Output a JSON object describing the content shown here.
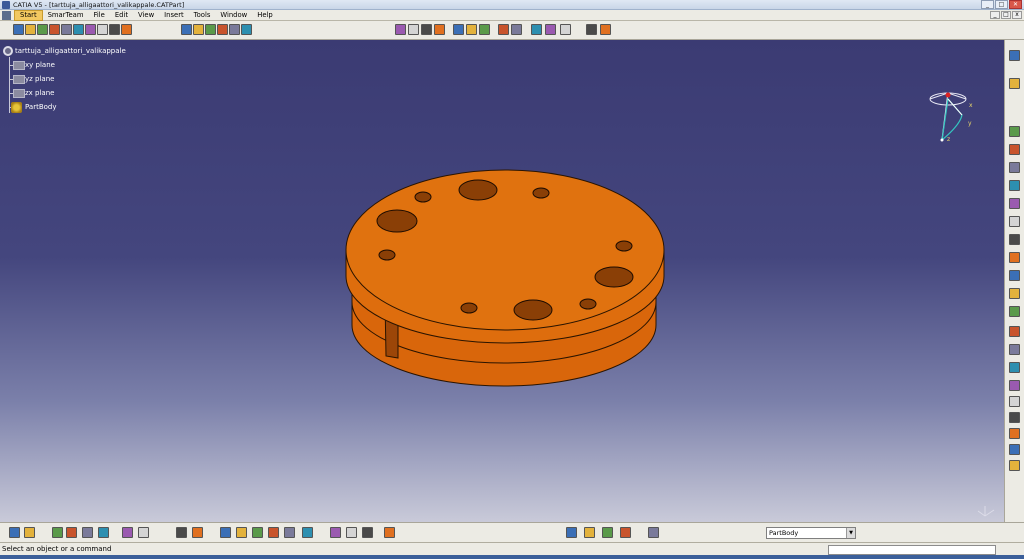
{
  "window": {
    "title": "CATIA V5 - [tarttuja_alligaattori_valikappale.CATPart]",
    "min_label": "_",
    "max_label": "□",
    "close_label": "✕"
  },
  "menu": {
    "items": [
      {
        "label": "Start"
      },
      {
        "label": "SmarTeam"
      },
      {
        "label": "File"
      },
      {
        "label": "Edit"
      },
      {
        "label": "View"
      },
      {
        "label": "Insert"
      },
      {
        "label": "Tools"
      },
      {
        "label": "Window"
      },
      {
        "label": "Help"
      }
    ],
    "mdi_min": "_",
    "mdi_max": "□",
    "mdi_close": "x"
  },
  "tree": {
    "root": "tarttuja_alligaattori_valikappale",
    "planes": [
      "xy plane",
      "yz plane",
      "zx plane"
    ],
    "body": "PartBody"
  },
  "compass": {
    "x_label": "x",
    "y_label": "y",
    "z_label": "z"
  },
  "bottom_toolbar": {
    "current_body": "PartBody",
    "fx_label": "f(x)"
  },
  "status": {
    "prompt": "Select an object or a command"
  },
  "colors": {
    "part_top": "#e0720f",
    "part_side": "#d9660b",
    "hole": "#8a3f06",
    "viewport_top": "#3b3b73",
    "viewport_bottom": "#c9cad9"
  },
  "icons": {
    "top_toolbar": [
      "new-icon",
      "open-icon",
      "save-icon",
      "print-icon",
      "cut-icon",
      "copy-icon",
      "paste-icon",
      "undo-icon",
      "redo-icon",
      "help-icon",
      "sketch-icon",
      "pad-icon",
      "pocket-icon",
      "shaft-icon",
      "groove-icon",
      "hole-icon",
      "fly-mode-icon",
      "fit-all-icon",
      "pan-icon",
      "rotate-icon",
      "zoom-in-icon",
      "zoom-out-icon",
      "normal-view-icon",
      "iso-view-icon",
      "view-mode-icon",
      "hide-show-icon",
      "swap-space-icon",
      "point-icon",
      "line-icon",
      "plane-icon"
    ],
    "right_toolbar": [
      "sketcher-icon",
      "exit-icon",
      "pad-icon",
      "pocket-icon",
      "shaft-icon",
      "groove-icon",
      "hole-icon",
      "rib-icon",
      "slot-icon",
      "stiffener-icon",
      "loft-icon",
      "fillet-icon",
      "chamfer-icon",
      "draft-icon",
      "shell-icon",
      "thickness-icon",
      "thread-icon",
      "split-icon",
      "mirror-icon",
      "pattern-icon",
      "scale-icon",
      "boolean-icon"
    ],
    "bottom_toolbar": [
      "formula-icon",
      "comment-icon",
      "table-icon",
      "catalog-icon",
      "parameter-icon",
      "measure-icon",
      "analysis-icon",
      "snap-icon",
      "axis-icon",
      "dress-up-icon",
      "constraint-icon",
      "publication-icon",
      "apply-material-icon",
      "render-icon",
      "grid-icon",
      "section-icon",
      "measure-between-icon",
      "inertia-icon",
      "scale-value-icon",
      "draft-analysis-icon",
      "curvature-icon",
      "object-repository-icon",
      "knowledge-icon",
      "product-icon",
      "workbench-icon"
    ]
  }
}
